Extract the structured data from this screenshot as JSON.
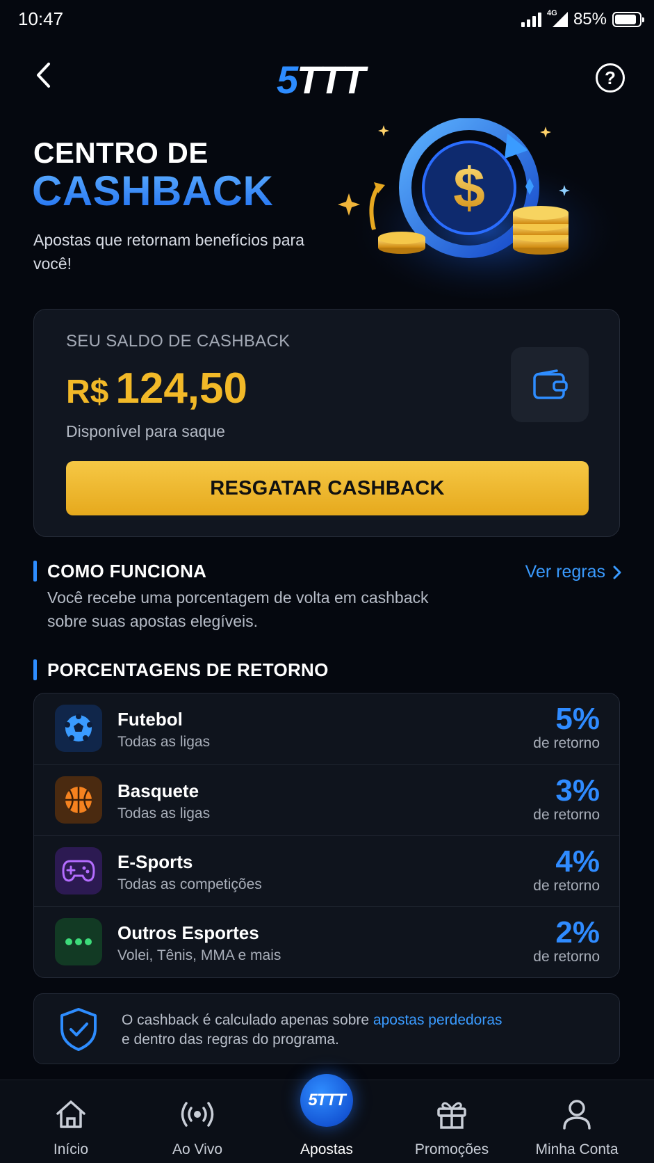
{
  "status_bar": {
    "time": "10:47",
    "network": "4G",
    "battery": "85%"
  },
  "header": {
    "logo_prefix": "5",
    "logo_suffix": "TTT",
    "help_label": "?"
  },
  "hero": {
    "title_line1": "CENTRO DE",
    "title_line2": "CASHBACK",
    "subtitle": "Apostas que retornam benefícios para você!"
  },
  "balance": {
    "label": "SEU SALDO DE CASHBACK",
    "currency": "R$",
    "amount": "124,50",
    "available": "Disponível para saque",
    "button": "RESGATAR CASHBACK"
  },
  "how_it_works": {
    "title": "COMO FUNCIONA",
    "link": "Ver regras",
    "description": "Você recebe uma porcentagem de volta em cashback sobre suas apostas elegíveis."
  },
  "percentages": {
    "title": "PORCENTAGENS DE RETORNO",
    "return_label": "de retorno",
    "items": [
      {
        "name": "Futebol",
        "desc": "Todas as ligas",
        "percent": "5%",
        "icon": "soccer-ball-icon",
        "icon_color": "#3a9bff"
      },
      {
        "name": "Basquete",
        "desc": "Todas as ligas",
        "percent": "3%",
        "icon": "basketball-icon",
        "icon_color": "#f5821f"
      },
      {
        "name": "E-Sports",
        "desc": "Todas as competições",
        "percent": "4%",
        "icon": "gamepad-icon",
        "icon_color": "#b46cff"
      },
      {
        "name": "Outros Esportes",
        "desc": "Volei, Tênis, MMA e mais",
        "percent": "2%",
        "icon": "more-dots-icon",
        "icon_color": "#3ddc7a"
      }
    ]
  },
  "note": {
    "text_before": "O cashback é calculado apenas sobre ",
    "highlight": "apostas perdedoras",
    "text_after": "e dentro das regras do programa."
  },
  "tabbar": {
    "items": [
      {
        "label": "Início",
        "icon": "home-icon"
      },
      {
        "label": "Ao Vivo",
        "icon": "live-broadcast-icon"
      },
      {
        "label": "Apostas",
        "icon": "5ttt-logo-icon",
        "active": true
      },
      {
        "label": "Promoções",
        "icon": "gift-icon"
      },
      {
        "label": "Minha Conta",
        "icon": "user-icon"
      }
    ],
    "center_badge": "5TTT"
  },
  "colors": {
    "accent": "#2e8dff",
    "gold": "#f2b928",
    "background": "#05080f"
  }
}
